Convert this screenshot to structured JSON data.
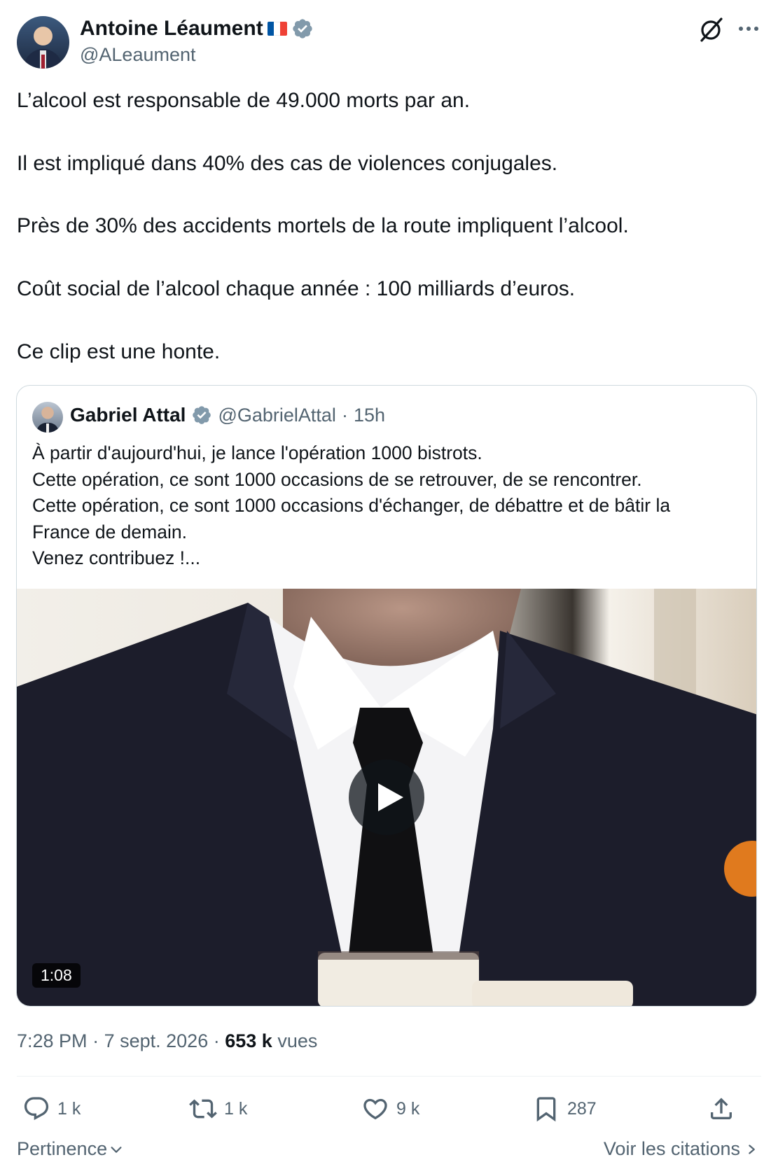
{
  "post": {
    "author_name": "Antoine Léaument",
    "author_handle": "@ALeaument",
    "flag_colors": [
      "#0055a4",
      "#ffffff",
      "#ef4135"
    ],
    "verified_color": "#829aab",
    "body": [
      "L’alcool est responsable de 49.000 morts par an.",
      "Il est impliqué dans 40% des cas de violences conjugales.",
      "Près de 30% des accidents mortels de la route impliquent l’alcool.",
      "Coût social de l’alcool chaque année : 100 milliards d’euros.",
      "Ce clip est une honte."
    ],
    "header_icons": [
      "grok-icon",
      "more-icon"
    ]
  },
  "quote": {
    "author_name": "Gabriel Attal",
    "author_handle": "@GabrielAttal",
    "separator": "·",
    "time_ago": "15h",
    "lines": [
      "À partir d'aujourd'hui, je lance l'opération 1000 bistrots.",
      "Cette opération, ce sont 1000 occasions de se retrouver, de se rencontrer.",
      "Cette opération, ce sont 1000 occasions d'échanger, de débattre et de bâtir la",
      "France de demain.",
      "Venez contribuez !..."
    ],
    "video": {
      "duration": "1:08",
      "icon": "play-icon"
    }
  },
  "meta": {
    "time": "7:28 PM",
    "sep": "·",
    "date": "7 sept. 2026",
    "views_count": "653 k",
    "views_label": "vues"
  },
  "actions": {
    "reply": "1 k",
    "repost": "1 k",
    "like": "9 k",
    "bookmark": "287"
  },
  "footer": {
    "sort_label": "Pertinence",
    "quotes_link": "Voir les citations"
  },
  "colors": {
    "text": "#0f1419",
    "secondary": "#536471",
    "border": "#cfd9de"
  }
}
